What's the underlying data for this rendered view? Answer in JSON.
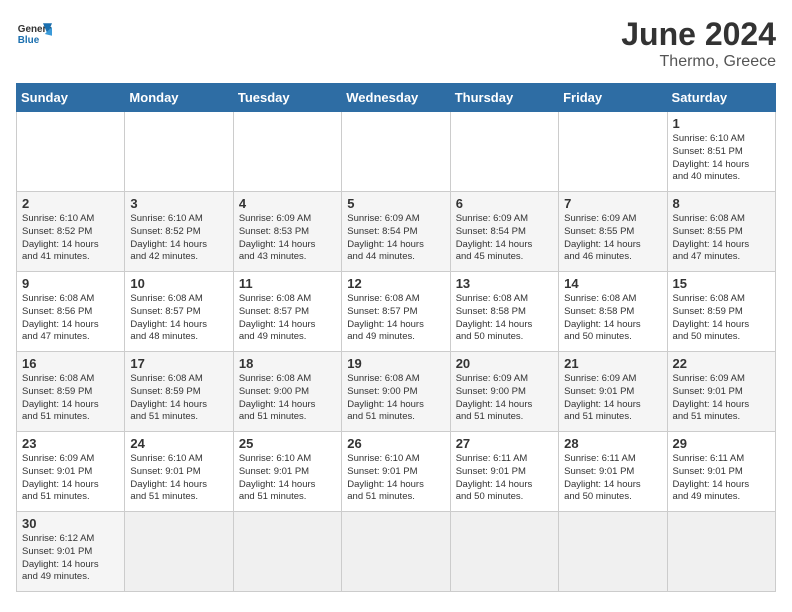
{
  "header": {
    "logo_general": "General",
    "logo_blue": "Blue",
    "month_year": "June 2024",
    "location": "Thermo, Greece"
  },
  "days_of_week": [
    "Sunday",
    "Monday",
    "Tuesday",
    "Wednesday",
    "Thursday",
    "Friday",
    "Saturday"
  ],
  "weeks": [
    {
      "days": [
        {
          "num": "",
          "info": ""
        },
        {
          "num": "",
          "info": ""
        },
        {
          "num": "",
          "info": ""
        },
        {
          "num": "",
          "info": ""
        },
        {
          "num": "",
          "info": ""
        },
        {
          "num": "",
          "info": ""
        },
        {
          "num": "1",
          "info": "Sunrise: 6:10 AM\nSunset: 8:51 PM\nDaylight: 14 hours\nand 40 minutes."
        }
      ]
    },
    {
      "days": [
        {
          "num": "2",
          "info": "Sunrise: 6:10 AM\nSunset: 8:52 PM\nDaylight: 14 hours\nand 41 minutes."
        },
        {
          "num": "3",
          "info": "Sunrise: 6:10 AM\nSunset: 8:52 PM\nDaylight: 14 hours\nand 42 minutes."
        },
        {
          "num": "4",
          "info": "Sunrise: 6:09 AM\nSunset: 8:53 PM\nDaylight: 14 hours\nand 43 minutes."
        },
        {
          "num": "5",
          "info": "Sunrise: 6:09 AM\nSunset: 8:54 PM\nDaylight: 14 hours\nand 44 minutes."
        },
        {
          "num": "6",
          "info": "Sunrise: 6:09 AM\nSunset: 8:54 PM\nDaylight: 14 hours\nand 45 minutes."
        },
        {
          "num": "7",
          "info": "Sunrise: 6:09 AM\nSunset: 8:55 PM\nDaylight: 14 hours\nand 46 minutes."
        },
        {
          "num": "8",
          "info": "Sunrise: 6:08 AM\nSunset: 8:55 PM\nDaylight: 14 hours\nand 47 minutes."
        }
      ]
    },
    {
      "days": [
        {
          "num": "9",
          "info": "Sunrise: 6:08 AM\nSunset: 8:56 PM\nDaylight: 14 hours\nand 47 minutes."
        },
        {
          "num": "10",
          "info": "Sunrise: 6:08 AM\nSunset: 8:57 PM\nDaylight: 14 hours\nand 48 minutes."
        },
        {
          "num": "11",
          "info": "Sunrise: 6:08 AM\nSunset: 8:57 PM\nDaylight: 14 hours\nand 49 minutes."
        },
        {
          "num": "12",
          "info": "Sunrise: 6:08 AM\nSunset: 8:57 PM\nDaylight: 14 hours\nand 49 minutes."
        },
        {
          "num": "13",
          "info": "Sunrise: 6:08 AM\nSunset: 8:58 PM\nDaylight: 14 hours\nand 50 minutes."
        },
        {
          "num": "14",
          "info": "Sunrise: 6:08 AM\nSunset: 8:58 PM\nDaylight: 14 hours\nand 50 minutes."
        },
        {
          "num": "15",
          "info": "Sunrise: 6:08 AM\nSunset: 8:59 PM\nDaylight: 14 hours\nand 50 minutes."
        }
      ]
    },
    {
      "days": [
        {
          "num": "16",
          "info": "Sunrise: 6:08 AM\nSunset: 8:59 PM\nDaylight: 14 hours\nand 51 minutes."
        },
        {
          "num": "17",
          "info": "Sunrise: 6:08 AM\nSunset: 8:59 PM\nDaylight: 14 hours\nand 51 minutes."
        },
        {
          "num": "18",
          "info": "Sunrise: 6:08 AM\nSunset: 9:00 PM\nDaylight: 14 hours\nand 51 minutes."
        },
        {
          "num": "19",
          "info": "Sunrise: 6:08 AM\nSunset: 9:00 PM\nDaylight: 14 hours\nand 51 minutes."
        },
        {
          "num": "20",
          "info": "Sunrise: 6:09 AM\nSunset: 9:00 PM\nDaylight: 14 hours\nand 51 minutes."
        },
        {
          "num": "21",
          "info": "Sunrise: 6:09 AM\nSunset: 9:01 PM\nDaylight: 14 hours\nand 51 minutes."
        },
        {
          "num": "22",
          "info": "Sunrise: 6:09 AM\nSunset: 9:01 PM\nDaylight: 14 hours\nand 51 minutes."
        }
      ]
    },
    {
      "days": [
        {
          "num": "23",
          "info": "Sunrise: 6:09 AM\nSunset: 9:01 PM\nDaylight: 14 hours\nand 51 minutes."
        },
        {
          "num": "24",
          "info": "Sunrise: 6:10 AM\nSunset: 9:01 PM\nDaylight: 14 hours\nand 51 minutes."
        },
        {
          "num": "25",
          "info": "Sunrise: 6:10 AM\nSunset: 9:01 PM\nDaylight: 14 hours\nand 51 minutes."
        },
        {
          "num": "26",
          "info": "Sunrise: 6:10 AM\nSunset: 9:01 PM\nDaylight: 14 hours\nand 51 minutes."
        },
        {
          "num": "27",
          "info": "Sunrise: 6:11 AM\nSunset: 9:01 PM\nDaylight: 14 hours\nand 50 minutes."
        },
        {
          "num": "28",
          "info": "Sunrise: 6:11 AM\nSunset: 9:01 PM\nDaylight: 14 hours\nand 50 minutes."
        },
        {
          "num": "29",
          "info": "Sunrise: 6:11 AM\nSunset: 9:01 PM\nDaylight: 14 hours\nand 49 minutes."
        }
      ]
    },
    {
      "days": [
        {
          "num": "30",
          "info": "Sunrise: 6:12 AM\nSunset: 9:01 PM\nDaylight: 14 hours\nand 49 minutes."
        },
        {
          "num": "",
          "info": ""
        },
        {
          "num": "",
          "info": ""
        },
        {
          "num": "",
          "info": ""
        },
        {
          "num": "",
          "info": ""
        },
        {
          "num": "",
          "info": ""
        },
        {
          "num": "",
          "info": ""
        }
      ]
    }
  ]
}
